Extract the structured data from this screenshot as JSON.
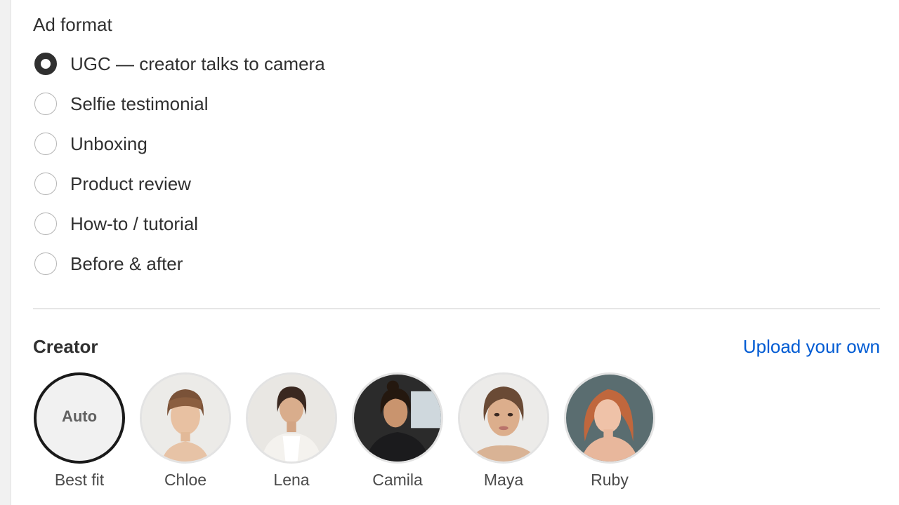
{
  "ad_format": {
    "title": "Ad format",
    "options": [
      {
        "label": "UGC — creator talks to camera",
        "checked": true
      },
      {
        "label": "Selfie testimonial",
        "checked": false
      },
      {
        "label": "Unboxing",
        "checked": false
      },
      {
        "label": "Product review",
        "checked": false
      },
      {
        "label": "How-to / tutorial",
        "checked": false
      },
      {
        "label": "Before & after",
        "checked": false
      }
    ]
  },
  "creator": {
    "title": "Creator",
    "upload_label": "Upload your own",
    "auto_label": "Auto",
    "items": [
      {
        "name": "Best fit",
        "selected": true
      },
      {
        "name": "Chloe",
        "selected": false
      },
      {
        "name": "Lena",
        "selected": false
      },
      {
        "name": "Camila",
        "selected": false
      },
      {
        "name": "Maya",
        "selected": false
      },
      {
        "name": "Ruby",
        "selected": false
      }
    ]
  },
  "colors": {
    "text": "#303030",
    "link": "#005bd3",
    "radio_checked": "#303030",
    "divider": "#e6e6e6"
  }
}
